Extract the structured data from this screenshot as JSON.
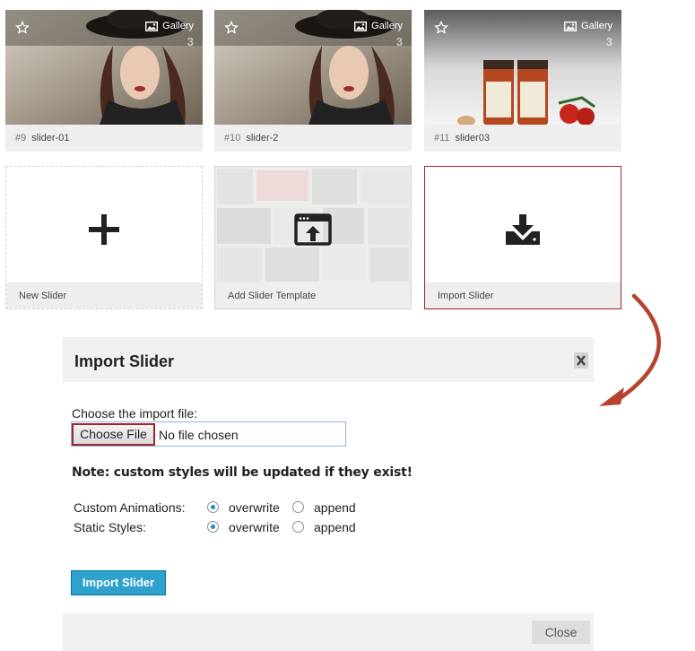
{
  "sliders": [
    {
      "id": "#9",
      "name": "slider-01",
      "gallery_label": "Gallery",
      "count": "3"
    },
    {
      "id": "#10",
      "name": "slider-2",
      "gallery_label": "Gallery",
      "count": "3"
    },
    {
      "id": "#11",
      "name": "slider03",
      "gallery_label": "Gallery",
      "count": "3"
    }
  ],
  "actions": {
    "new_slider": "New Slider",
    "add_template": "Add Slider Template",
    "import_slider": "Import Slider"
  },
  "dialog": {
    "title": "Import Slider",
    "choose_label": "Choose the import file:",
    "choose_button": "Choose File",
    "no_file": "No file chosen",
    "note": "Note: custom styles will be updated if they exist!",
    "rows": [
      {
        "label": "Custom Animations:",
        "selected": "overwrite",
        "opt1": "overwrite",
        "opt2": "append"
      },
      {
        "label": "Static Styles:",
        "selected": "overwrite",
        "opt1": "overwrite",
        "opt2": "append"
      }
    ],
    "import_button": "Import Slider",
    "close_button": "Close"
  },
  "colors": {
    "accent": "#2ea2cc",
    "highlight_border": "#a5232a",
    "arrow": "#c0392b"
  }
}
